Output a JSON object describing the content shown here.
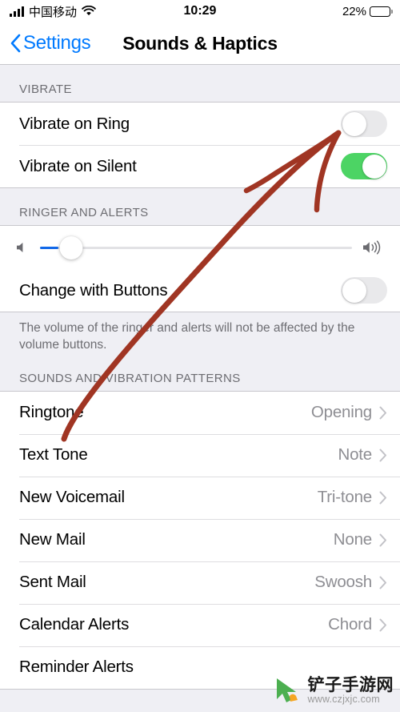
{
  "status_bar": {
    "carrier": "中国移动",
    "signal_icon": "signal-bars-icon",
    "wifi_icon": "wifi-icon",
    "time": "10:29",
    "battery_percent": "22%",
    "battery_fill_color": "#f5c423",
    "battery_level": 22
  },
  "nav": {
    "back_label": "Settings",
    "back_icon": "chevron-left-icon",
    "title": "Sounds & Haptics",
    "accent_color": "#007aff"
  },
  "sections": {
    "vibrate": {
      "header": "VIBRATE",
      "rows": [
        {
          "label": "Vibrate on Ring",
          "toggle": "off"
        },
        {
          "label": "Vibrate on Silent",
          "toggle": "on"
        }
      ]
    },
    "ringer": {
      "header": "RINGER AND ALERTS",
      "slider": {
        "min_icon": "speaker-mute-icon",
        "max_icon": "speaker-loud-icon",
        "value": 13,
        "fill_color": "#1168e8"
      },
      "row": {
        "label": "Change with Buttons",
        "toggle": "off"
      },
      "footer": "The volume of the ringer and alerts will not be affected by the volume buttons."
    },
    "patterns": {
      "header": "SOUNDS AND VIBRATION PATTERNS",
      "rows": [
        {
          "label": "Ringtone",
          "value": "Opening"
        },
        {
          "label": "Text Tone",
          "value": "Note"
        },
        {
          "label": "New Voicemail",
          "value": "Tri-tone"
        },
        {
          "label": "New Mail",
          "value": "None"
        },
        {
          "label": "Sent Mail",
          "value": "Swoosh"
        },
        {
          "label": "Calendar Alerts",
          "value": "Chord"
        },
        {
          "label": "Reminder Alerts",
          "value": ""
        }
      ]
    }
  },
  "annotation": {
    "type": "arrow",
    "color": "#a03523",
    "points_to": "vibrate-on-ring-toggle"
  },
  "watermark": {
    "title": "铲子手游网",
    "url": "www.czjxjc.com",
    "mark_color": "#4caf50"
  },
  "toggle_colors": {
    "on": "#4cd464",
    "off": "#e9e9eb"
  }
}
